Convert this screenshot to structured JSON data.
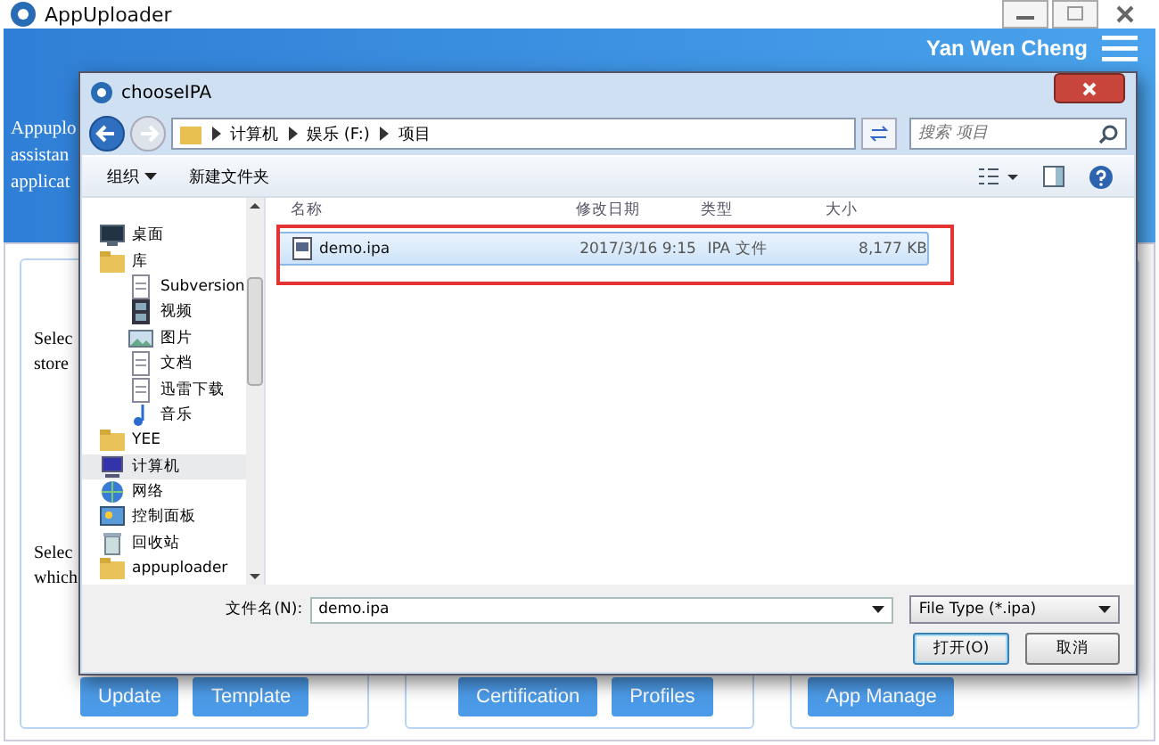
{
  "window": {
    "title": "AppUploader"
  },
  "header": {
    "user": "Yan Wen Cheng"
  },
  "intro": [
    "Appuplo",
    "assistan",
    "applicat"
  ],
  "cards": [
    {
      "texts": [
        "Selec",
        "store"
      ],
      "buttons": [
        "Update",
        "Template"
      ]
    },
    {
      "buttons": [
        "Certification",
        "Profiles"
      ]
    },
    {
      "buttons": [
        "App Manage"
      ]
    }
  ],
  "side_texts": [
    "Selec",
    "which"
  ],
  "dialog": {
    "title": "chooseIPA",
    "breadcrumb": [
      "计算机",
      "娱乐 (F:)",
      "项目"
    ],
    "search": {
      "placeholder": "搜索 项目"
    },
    "toolbar": [
      "组织",
      "新建文件夹"
    ],
    "nav": [
      {
        "label": "桌面",
        "selected": false
      },
      {
        "label": "库",
        "selected": false,
        "children": [
          {
            "label": "Subversion",
            "selected": false
          },
          {
            "label": "视频",
            "selected": false
          },
          {
            "label": "图片",
            "selected": false
          },
          {
            "label": "文档",
            "selected": false
          },
          {
            "label": "迅雷下载",
            "selected": false
          },
          {
            "label": "音乐",
            "selected": false
          }
        ]
      },
      {
        "label": "YEE",
        "selected": false
      },
      {
        "label": "计算机",
        "selected": true
      },
      {
        "label": "网络",
        "selected": false
      },
      {
        "label": "控制面板",
        "selected": false
      },
      {
        "label": "回收站",
        "selected": false
      },
      {
        "label": "appuploader",
        "selected": false
      }
    ],
    "columns": [
      "名称",
      "修改日期",
      "类型",
      "大小"
    ],
    "files": [
      {
        "name": "demo.ipa",
        "modified": "2017/3/16 9:15",
        "type": "IPA 文件",
        "size": "8,177 KB",
        "selected": true
      }
    ],
    "filename_label": "文件名(N):",
    "filename": "demo.ipa",
    "filetype": "File Type (*.ipa)",
    "buttons": [
      "打开(O)",
      "取消"
    ]
  }
}
